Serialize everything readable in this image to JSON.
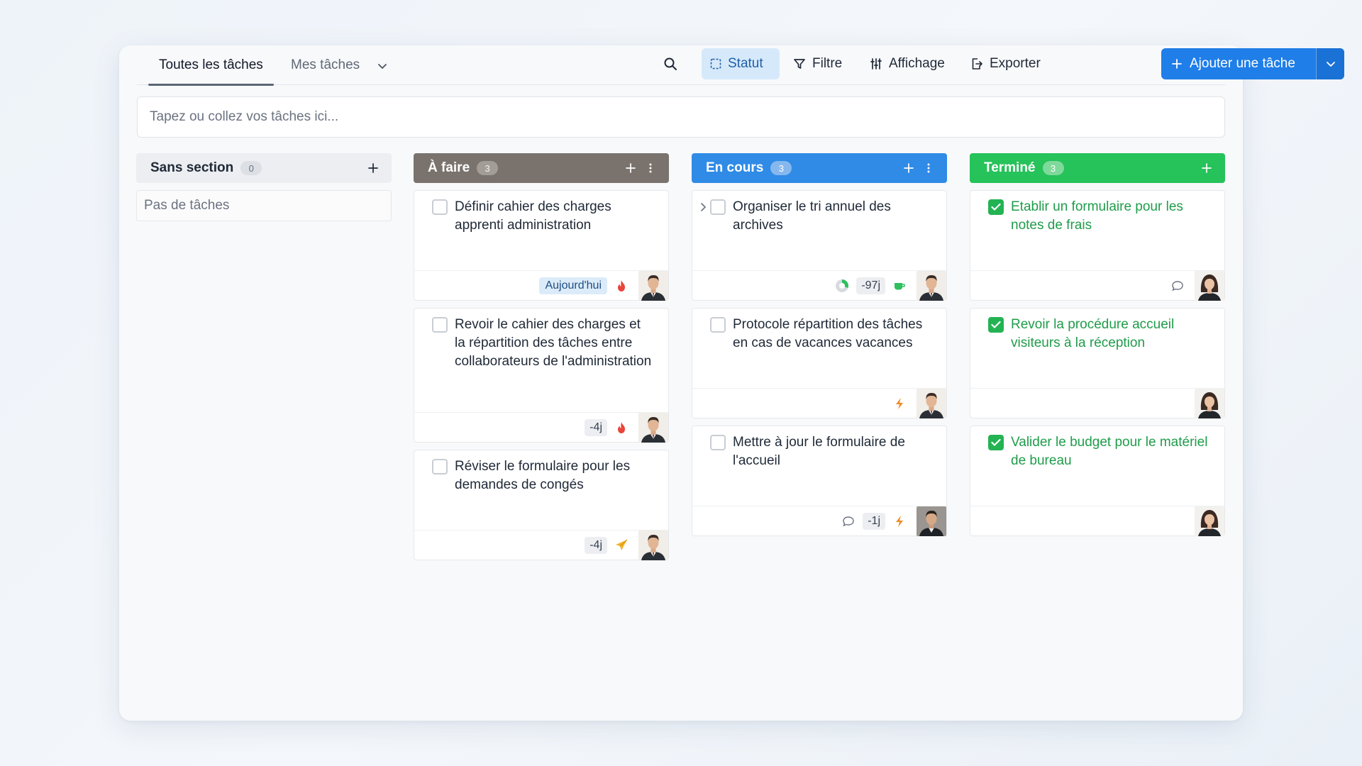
{
  "tabs": [
    {
      "label": "Toutes les tâches",
      "active": true
    },
    {
      "label": "Mes tâches",
      "active": false
    }
  ],
  "toolbar": {
    "statut": "Statut",
    "filtre": "Filtre",
    "affichage": "Affichage",
    "exporter": "Exporter",
    "add_task": "Ajouter une tâche"
  },
  "quickadd": {
    "placeholder": "Tapez ou collez vos tâches ici..."
  },
  "colors": {
    "brand": "#1f7ee8",
    "todo": "#7a736d",
    "in_progress": "#2f8be6",
    "done": "#26c25a"
  },
  "columns": [
    {
      "title": "Sans section",
      "count": "0",
      "empty_text": "Pas de tâches",
      "cards": []
    },
    {
      "title": "À faire",
      "count": "3",
      "cards": [
        {
          "title": "Définir cahier des charges apprenti administration",
          "date": "Aujourd'hui",
          "priority_icon": "flame-icon",
          "avatar": "man-avatar"
        },
        {
          "title": "Revoir le cahier des charges et la répartition des tâches entre collaborateurs de l'administration",
          "date": "-4j",
          "priority_icon": "flame-icon",
          "avatar": "man-avatar"
        },
        {
          "title": "Réviser le formulaire pour les demandes de congés",
          "date": "-4j",
          "priority_icon": "paper-plane-icon",
          "avatar": "man-avatar"
        }
      ]
    },
    {
      "title": "En cours",
      "count": "3",
      "cards": [
        {
          "title": "Organiser le tri annuel des archives",
          "date": "-97j",
          "progress_icon": "progress-pie-icon",
          "priority_icon": "coffee-icon",
          "avatar": "man-avatar",
          "has_subtasks": true
        },
        {
          "title": "Protocole répartition des tâches en cas de vacances vacances",
          "priority_icon": "lightning-icon",
          "avatar": "man-avatar"
        },
        {
          "title": "Mettre à jour le formulaire de l'accueil",
          "date": "-1j",
          "comment_icon": "comment-icon",
          "priority_icon": "lightning-icon",
          "avatar": "man-avatar-dark"
        }
      ]
    },
    {
      "title": "Terminé",
      "count": "3",
      "cards": [
        {
          "title": "Etablir un formulaire pour les notes de frais",
          "comment_icon": "comment-icon",
          "avatar": "woman-avatar"
        },
        {
          "title": "Revoir la procédure accueil visiteurs à la réception",
          "avatar": "woman-avatar"
        },
        {
          "title": "Valider le budget pour le matériel de bureau",
          "avatar": "woman-avatar"
        }
      ]
    }
  ]
}
